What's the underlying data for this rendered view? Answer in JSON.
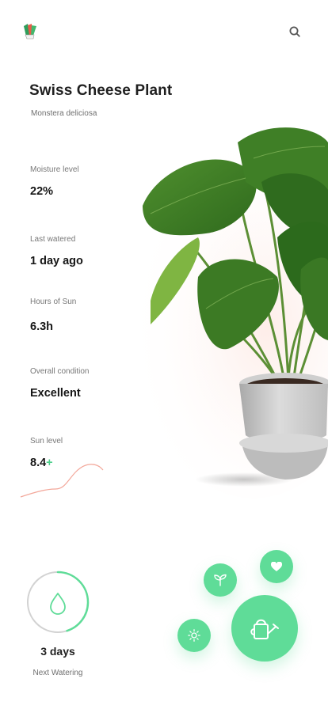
{
  "plant": {
    "common_name": "Swiss Cheese Plant",
    "latin_name": "Monstera deliciosa"
  },
  "stats": [
    {
      "label": "Moisture level",
      "value": "22%"
    },
    {
      "label": "Last watered",
      "value": "1 day ago"
    },
    {
      "label": "Hours of Sun",
      "value": "6.3h"
    },
    {
      "label": "Overall condition",
      "value": "Excellent"
    }
  ],
  "sun": {
    "label": "Sun level",
    "value": "8.4",
    "trend_symbol": "+"
  },
  "watering": {
    "value": "3 days",
    "label": "Next Watering",
    "progress": 0.45
  },
  "icons": {
    "logo": "plant-logo-icon",
    "search": "search-icon",
    "heart": "heart-icon",
    "leaf": "sprout-icon",
    "sun": "sun-icon",
    "water": "watering-can-icon",
    "drop": "water-drop-icon"
  },
  "colors": {
    "accent": "#5fdc98",
    "trend_up": "#4fd08d",
    "sun_line": "#f3a79a",
    "text": "#1f1f1f",
    "muted": "#6f6f6f"
  }
}
